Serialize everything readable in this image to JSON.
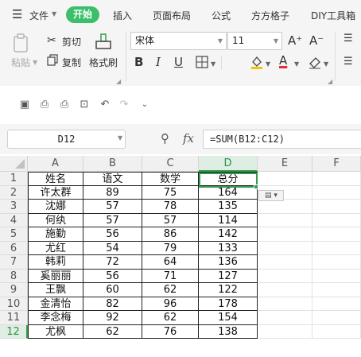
{
  "menubar": {
    "hamburger_icon": "menu-icon",
    "file_label": "文件",
    "start_label": "开始",
    "tabs": [
      "插入",
      "页面布局",
      "公式",
      "方方格子",
      "DIY工具箱"
    ]
  },
  "ribbon": {
    "paste_label": "粘贴",
    "cut_label": "剪切",
    "copy_label": "复制",
    "format_painter_label": "格式刷",
    "font_name": "宋体",
    "font_size": "11",
    "bold": "B",
    "italic": "I",
    "underline": "U",
    "font_color_letter": "A",
    "increase_font": "A⁺",
    "decrease_font": "A⁻",
    "accent_color": "#3bbf6a",
    "font_color": "#e03030",
    "fill_color": "#f2c200"
  },
  "formulabar": {
    "cell_ref": "D12",
    "fx_label": "fx",
    "formula": "=SUM(B12:C12)"
  },
  "sheet": {
    "columns": [
      "A",
      "B",
      "C",
      "D",
      "E",
      "F"
    ],
    "rows": [
      "1",
      "2",
      "3",
      "4",
      "5",
      "6",
      "7",
      "8",
      "9",
      "10",
      "11",
      "12"
    ],
    "active_cell": "D12",
    "data": [
      [
        "姓名",
        "语文",
        "数学",
        "总分"
      ],
      [
        "许太群",
        "89",
        "75",
        "164"
      ],
      [
        "沈娜",
        "57",
        "78",
        "135"
      ],
      [
        "何纨",
        "57",
        "57",
        "114"
      ],
      [
        "施勤",
        "56",
        "86",
        "142"
      ],
      [
        "尤红",
        "54",
        "79",
        "133"
      ],
      [
        "韩莉",
        "72",
        "64",
        "136"
      ],
      [
        "奚丽丽",
        "56",
        "71",
        "127"
      ],
      [
        "王飘",
        "60",
        "62",
        "122"
      ],
      [
        "金清怡",
        "82",
        "96",
        "178"
      ],
      [
        "李念梅",
        "92",
        "62",
        "154"
      ],
      [
        "尤枫",
        "62",
        "76",
        "138"
      ]
    ]
  }
}
